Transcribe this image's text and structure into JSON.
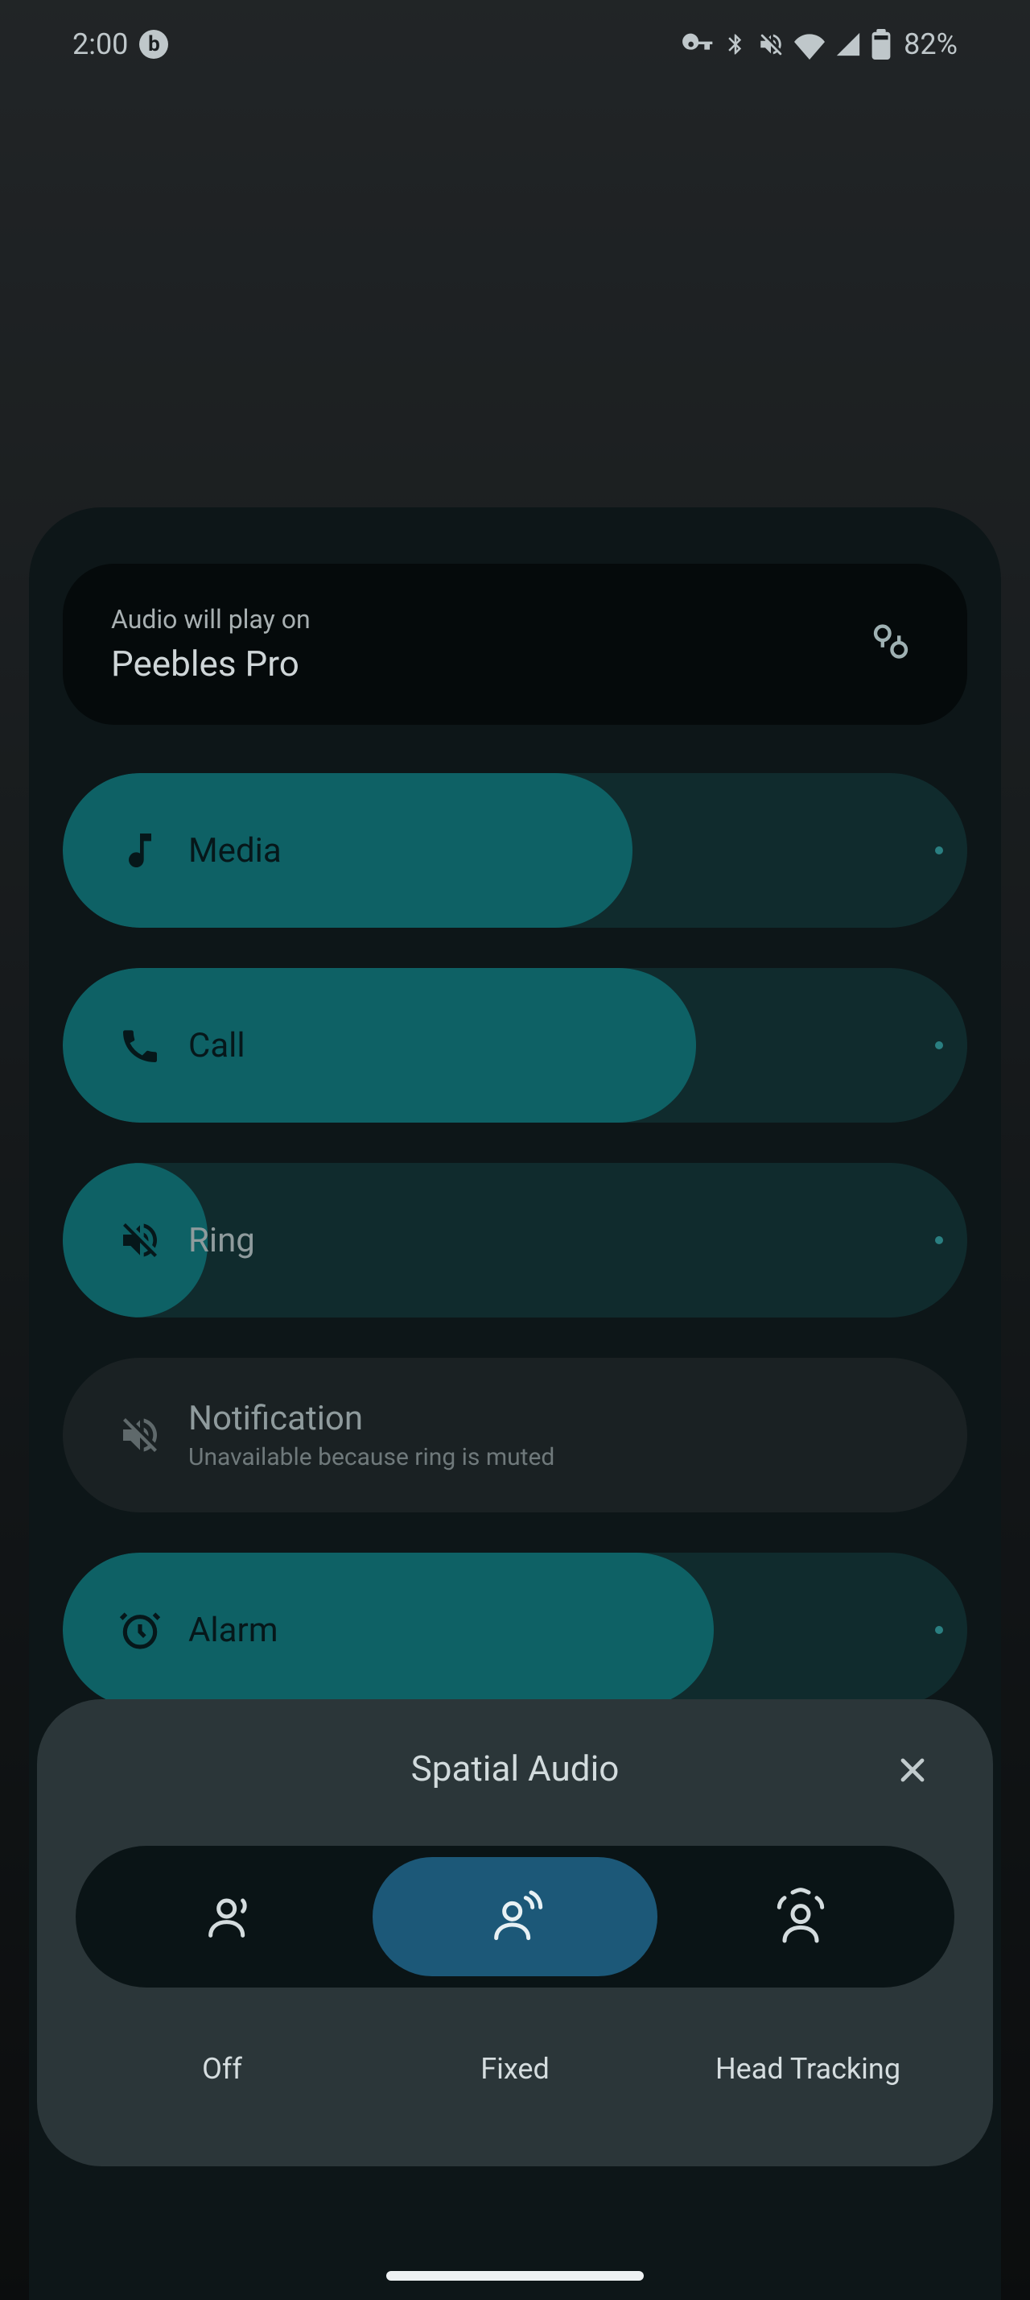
{
  "status": {
    "time": "2:00",
    "app_indicator": "b",
    "battery": "82%"
  },
  "header": {
    "subtitle": "Audio will play on",
    "device": "Peebles Pro"
  },
  "sliders": {
    "media": {
      "label": "Media",
      "fill_pct": 63
    },
    "call": {
      "label": "Call",
      "fill_pct": 70
    },
    "ring": {
      "label": "Ring",
      "fill_pct": 16
    },
    "notification": {
      "label": "Notification",
      "sublabel": "Unavailable because ring is muted"
    },
    "alarm": {
      "label": "Alarm",
      "fill_pct": 72
    }
  },
  "spatial": {
    "title": "Spatial Audio",
    "options": {
      "off": "Off",
      "fixed": "Fixed",
      "tracking": "Head Tracking"
    },
    "selected": "fixed"
  }
}
